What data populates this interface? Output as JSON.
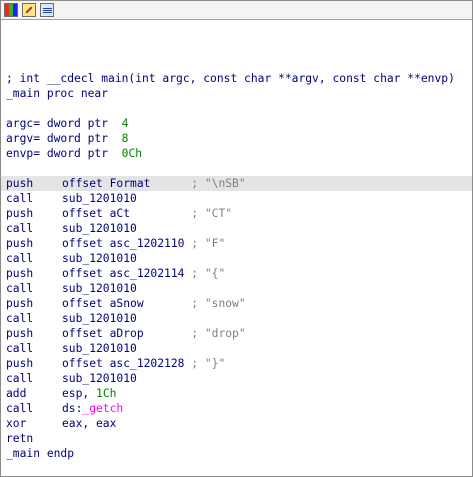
{
  "toolbar": {
    "buttons": [
      {
        "name": "graph-view-icon"
      },
      {
        "name": "edit-icon"
      },
      {
        "name": "text-view-icon"
      }
    ]
  },
  "code": {
    "signature": "; int __cdecl main(int argc, const char **argv, const char **envp)",
    "proc_name": "_main",
    "proc_kw": "proc near",
    "vars": [
      {
        "name": "argc=",
        "type": "dword ptr",
        "offset": "4"
      },
      {
        "name": "argv=",
        "type": "dword ptr",
        "offset": "8"
      },
      {
        "name": "envp=",
        "type": "dword ptr",
        "offset": "0Ch"
      }
    ],
    "instructions": [
      {
        "mnemonic": "push",
        "operand": "offset Format",
        "comment": "; \"\\nSB\""
      },
      {
        "mnemonic": "call",
        "operand": "sub_1201010",
        "comment": ""
      },
      {
        "mnemonic": "push",
        "operand": "offset aCt",
        "comment": "; \"CT\""
      },
      {
        "mnemonic": "call",
        "operand": "sub_1201010",
        "comment": ""
      },
      {
        "mnemonic": "push",
        "operand": "offset asc_1202110",
        "comment": "; \"F\""
      },
      {
        "mnemonic": "call",
        "operand": "sub_1201010",
        "comment": ""
      },
      {
        "mnemonic": "push",
        "operand": "offset asc_1202114",
        "comment": "; \"{\""
      },
      {
        "mnemonic": "call",
        "operand": "sub_1201010",
        "comment": ""
      },
      {
        "mnemonic": "push",
        "operand": "offset aSnow",
        "comment": "; \"snow\""
      },
      {
        "mnemonic": "call",
        "operand": "sub_1201010",
        "comment": ""
      },
      {
        "mnemonic": "push",
        "operand": "offset aDrop",
        "comment": "; \"drop\""
      },
      {
        "mnemonic": "call",
        "operand": "sub_1201010",
        "comment": ""
      },
      {
        "mnemonic": "push",
        "operand": "offset asc_1202128",
        "comment": "; \"}\""
      },
      {
        "mnemonic": "call",
        "operand": "sub_1201010",
        "comment": ""
      }
    ],
    "add": {
      "mnemonic": "add",
      "operand_reg": "esp, ",
      "operand_num": "1Ch"
    },
    "getch": {
      "mnemonic": "call",
      "operand_prefix": "ds:",
      "operand_import": "_getch"
    },
    "xor": {
      "mnemonic": "xor",
      "operand": "eax, eax"
    },
    "retn": {
      "mnemonic": "retn"
    },
    "endp": {
      "proc_name": "_main",
      "kw": "endp"
    }
  },
  "colors": {
    "code": "#000080",
    "number": "#008000",
    "comment": "#808080",
    "import": "#ff00ff",
    "highlight": "#e4e4e4"
  }
}
